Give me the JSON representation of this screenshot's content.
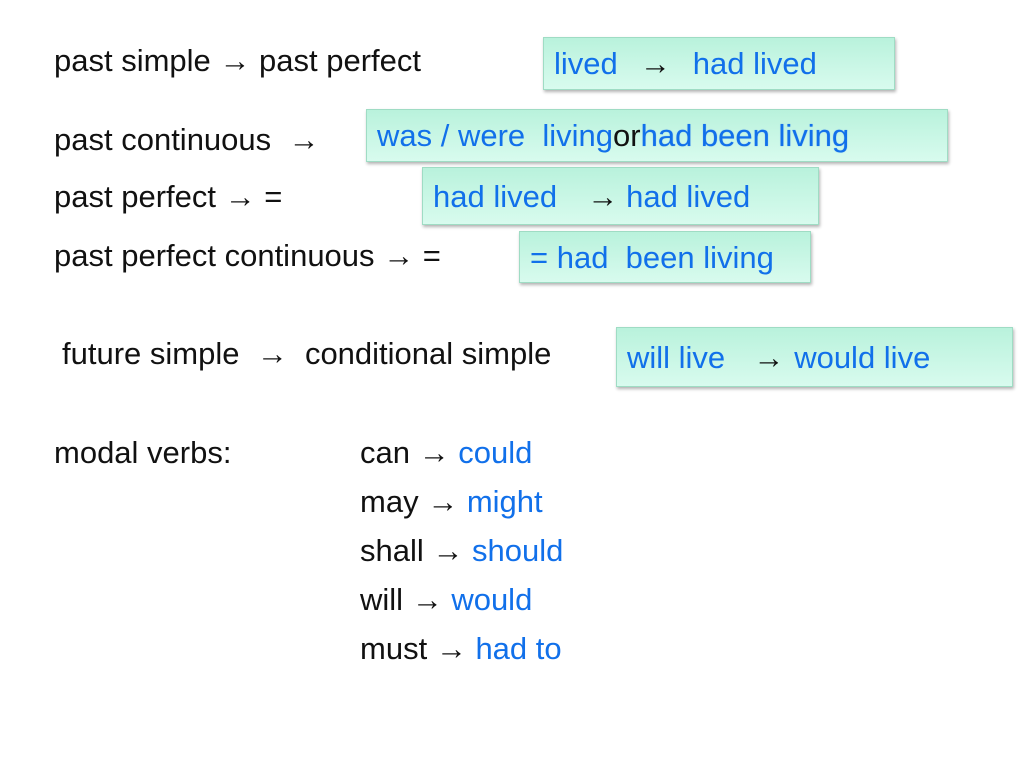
{
  "arrow": "→",
  "rows": {
    "past_simple": {
      "label": "past simple",
      "target": "past perfect",
      "from": "lived",
      "to": "had lived"
    },
    "past_continuous": {
      "label": "past continuous",
      "opt1": "was / were  living",
      "or": "or",
      "opt2": "had been living"
    },
    "past_perfect": {
      "label": "past perfect",
      "eq": "=",
      "from": "had lived",
      "to": "had lived"
    },
    "past_perfect_continuous": {
      "label": "past perfect continuous",
      "eq": "=",
      "value": "= had  been living"
    },
    "future_simple": {
      "label": "future simple",
      "target": "conditional simple",
      "from": "will live",
      "to": "would live"
    }
  },
  "modal": {
    "label": "modal verbs:",
    "items": [
      {
        "from": "can",
        "to": "could"
      },
      {
        "from": "may",
        "to": "might"
      },
      {
        "from": "shall",
        "to": "should"
      },
      {
        "from": "will",
        "to": "would"
      },
      {
        "from": "must",
        "to": "had to"
      }
    ]
  },
  "colors": {
    "blue_text": "#1170ea",
    "box_fill": "#c8f5e4"
  }
}
